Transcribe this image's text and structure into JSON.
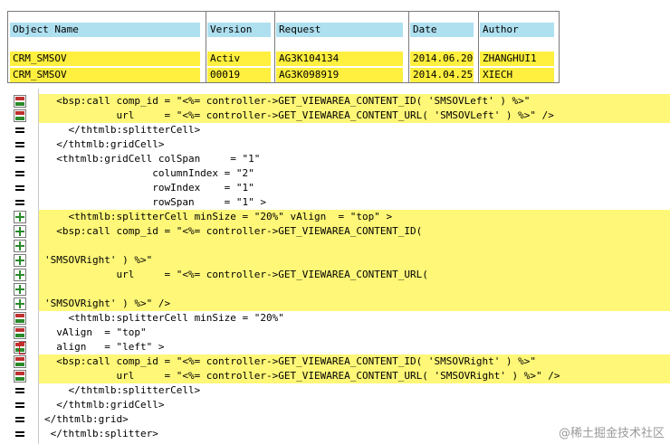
{
  "table": {
    "headers": [
      "Object Name",
      "Version",
      "Request",
      "Date",
      "Author"
    ],
    "rows": [
      [
        "CRM_SMSOV",
        "Activ",
        "AG3K104134",
        "2014.06.20",
        "ZHANGHUI1"
      ],
      [
        "CRM_SMSOV",
        "00019",
        "AG3K098919",
        "2014.04.25",
        "XIECH"
      ]
    ]
  },
  "code": {
    "lines": [
      {
        "icon": "chg",
        "hl": true,
        "text": "  <bsp:call comp_id = \"<%= controller->GET_VIEWAREA_CONTENT_ID( 'SMSOVLeft' ) %>\""
      },
      {
        "icon": "chg",
        "hl": true,
        "text": "            url     = \"<%= controller->GET_VIEWAREA_CONTENT_URL( 'SMSOVLeft' ) %>\" />"
      },
      {
        "icon": "eq",
        "hl": false,
        "text": "    </thtmlb:splitterCell>"
      },
      {
        "icon": "eq",
        "hl": false,
        "text": "  </thtmlb:gridCell>"
      },
      {
        "icon": "eq",
        "hl": false,
        "text": "  <thtmlb:gridCell colSpan     = \"1\""
      },
      {
        "icon": "eq",
        "hl": false,
        "text": "                  columnIndex = \"2\""
      },
      {
        "icon": "eq",
        "hl": false,
        "text": "                  rowIndex    = \"1\""
      },
      {
        "icon": "eq",
        "hl": false,
        "text": "                  rowSpan     = \"1\" >"
      },
      {
        "icon": "add",
        "hl": true,
        "text": "    <thtmlb:splitterCell minSize = \"20%\" vAlign  = \"top\" >"
      },
      {
        "icon": "add",
        "hl": true,
        "text": "  <bsp:call comp_id = \"<%= controller->GET_VIEWAREA_CONTENT_ID("
      },
      {
        "icon": "add",
        "hl": true,
        "text": ""
      },
      {
        "icon": "add",
        "hl": true,
        "text": "'SMSOVRight' ) %>\""
      },
      {
        "icon": "add",
        "hl": true,
        "text": "            url     = \"<%= controller->GET_VIEWAREA_CONTENT_URL("
      },
      {
        "icon": "add",
        "hl": true,
        "text": ""
      },
      {
        "icon": "add",
        "hl": true,
        "text": "'SMSOVRight' ) %>\" />"
      },
      {
        "icon": "chg",
        "hl": false,
        "text": "    <thtmlb:splitterCell minSize = \"20%\""
      },
      {
        "icon": "chg",
        "hl": false,
        "text": "  vAlign  = \"top\""
      },
      {
        "icon": "chg",
        "hl": false,
        "marker": true,
        "text": "  align   = \"left\" >"
      },
      {
        "icon": "chg",
        "hl": true,
        "text": "  <bsp:call comp_id = \"<%= controller->GET_VIEWAREA_CONTENT_ID( 'SMSOVRight' ) %>\""
      },
      {
        "icon": "chg",
        "hl": true,
        "text": "            url     = \"<%= controller->GET_VIEWAREA_CONTENT_URL( 'SMSOVRight' ) %>\" />"
      },
      {
        "icon": "eq",
        "hl": false,
        "text": "    </thtmlb:splitterCell>"
      },
      {
        "icon": "eq",
        "hl": false,
        "text": "  </thtmlb:gridCell>"
      },
      {
        "icon": "eq",
        "hl": false,
        "text": "</thtmlb:grid>"
      },
      {
        "icon": "eq",
        "hl": false,
        "text": " </thtmlb:splitter>"
      }
    ]
  },
  "watermark": "@稀土掘金技术社区"
}
